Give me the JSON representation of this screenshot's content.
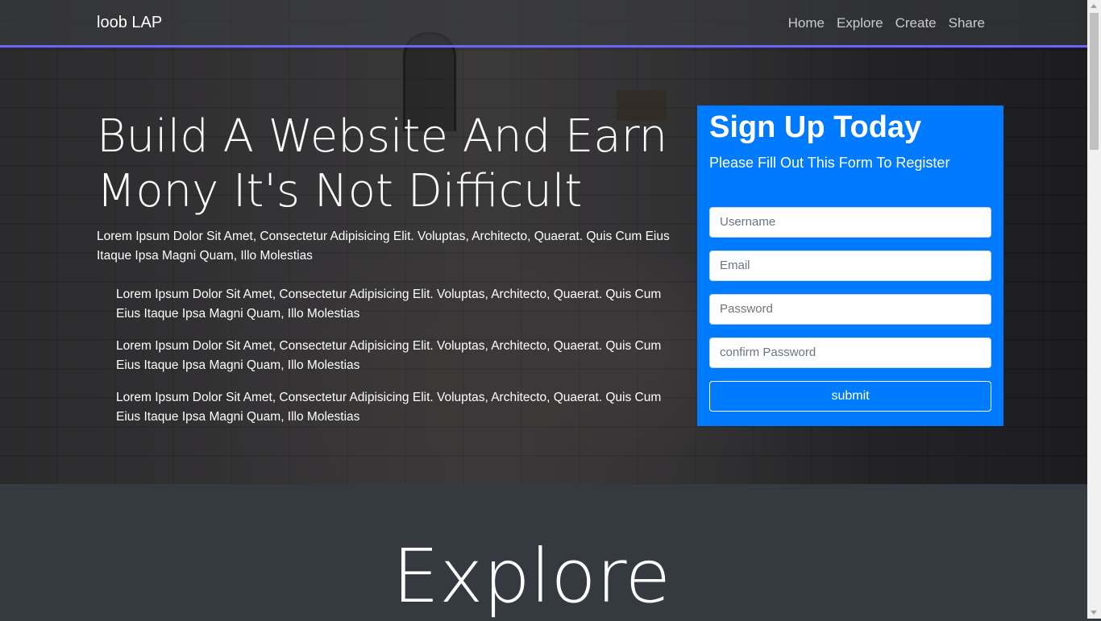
{
  "navbar": {
    "brand": "loob LAP",
    "links": [
      "Home",
      "Explore",
      "Create",
      "Share"
    ]
  },
  "hero": {
    "headline_line1": "Build A Website And Earn",
    "headline_line2": "Mony It's Not Difficult",
    "lead": "Lorem Ipsum Dolor Sit Amet, Consectetur Adipisicing Elit. Voluptas, Architecto, Quaerat. Quis Cum Eius Itaque Ipsa Magni Quam, Illo Molestias",
    "items": [
      "Lorem Ipsum Dolor Sit Amet, Consectetur Adipisicing Elit. Voluptas, Architecto, Quaerat. Quis Cum Eius Itaque Ipsa Magni Quam, Illo Molestias",
      "Lorem Ipsum Dolor Sit Amet, Consectetur Adipisicing Elit. Voluptas, Architecto, Quaerat. Quis Cum Eius Itaque Ipsa Magni Quam, Illo Molestias",
      "Lorem Ipsum Dolor Sit Amet, Consectetur Adipisicing Elit. Voluptas, Architecto, Quaerat. Quis Cum Eius Itaque Ipsa Magni Quam, Illo Molestias"
    ]
  },
  "signup": {
    "title": "Sign Up Today",
    "subtitle": "Please Fill Out This Form To Register",
    "username_placeholder": "Username",
    "email_placeholder": "Email",
    "password_placeholder": "Password",
    "confirm_placeholder": "confirm Password",
    "submit_label": "submit"
  },
  "explore": {
    "title": "Explore"
  },
  "colors": {
    "accent": "#007bff",
    "nav_border": "#6c63ff",
    "section_bg": "#343a40"
  }
}
